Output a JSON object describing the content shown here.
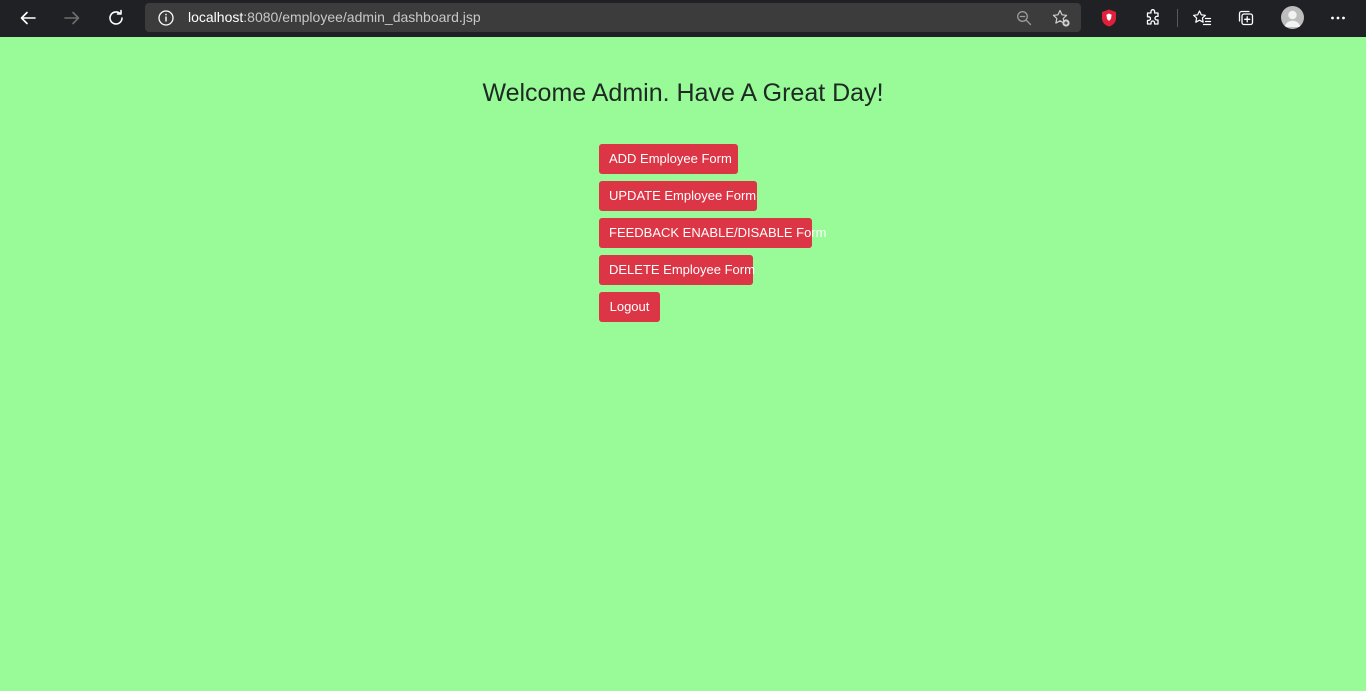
{
  "browser": {
    "url_host": "localhost",
    "url_rest": ":8080/employee/admin_dashboard.jsp",
    "icons": [
      "back-icon",
      "forward-icon",
      "reload-icon",
      "info-icon",
      "zoom-icon",
      "add-favorite-icon",
      "brave-shield-icon",
      "extensions-icon",
      "favorites-icon",
      "collections-icon",
      "profile-avatar",
      "more-icon"
    ]
  },
  "page": {
    "title": "Welcome Admin. Have A Great Day!",
    "buttons": {
      "add": "ADD Employee Form",
      "update": "UPDATE Employee Form",
      "feedback": "FEEDBACK ENABLE/DISABLE Form",
      "delete": "DELETE Employee Form",
      "logout": "Logout"
    }
  },
  "colors": {
    "background": "#98fb98",
    "button": "#dc3545",
    "button_text": "#ffffff",
    "title_text": "#1e2a23",
    "toolbar": "#202124"
  }
}
